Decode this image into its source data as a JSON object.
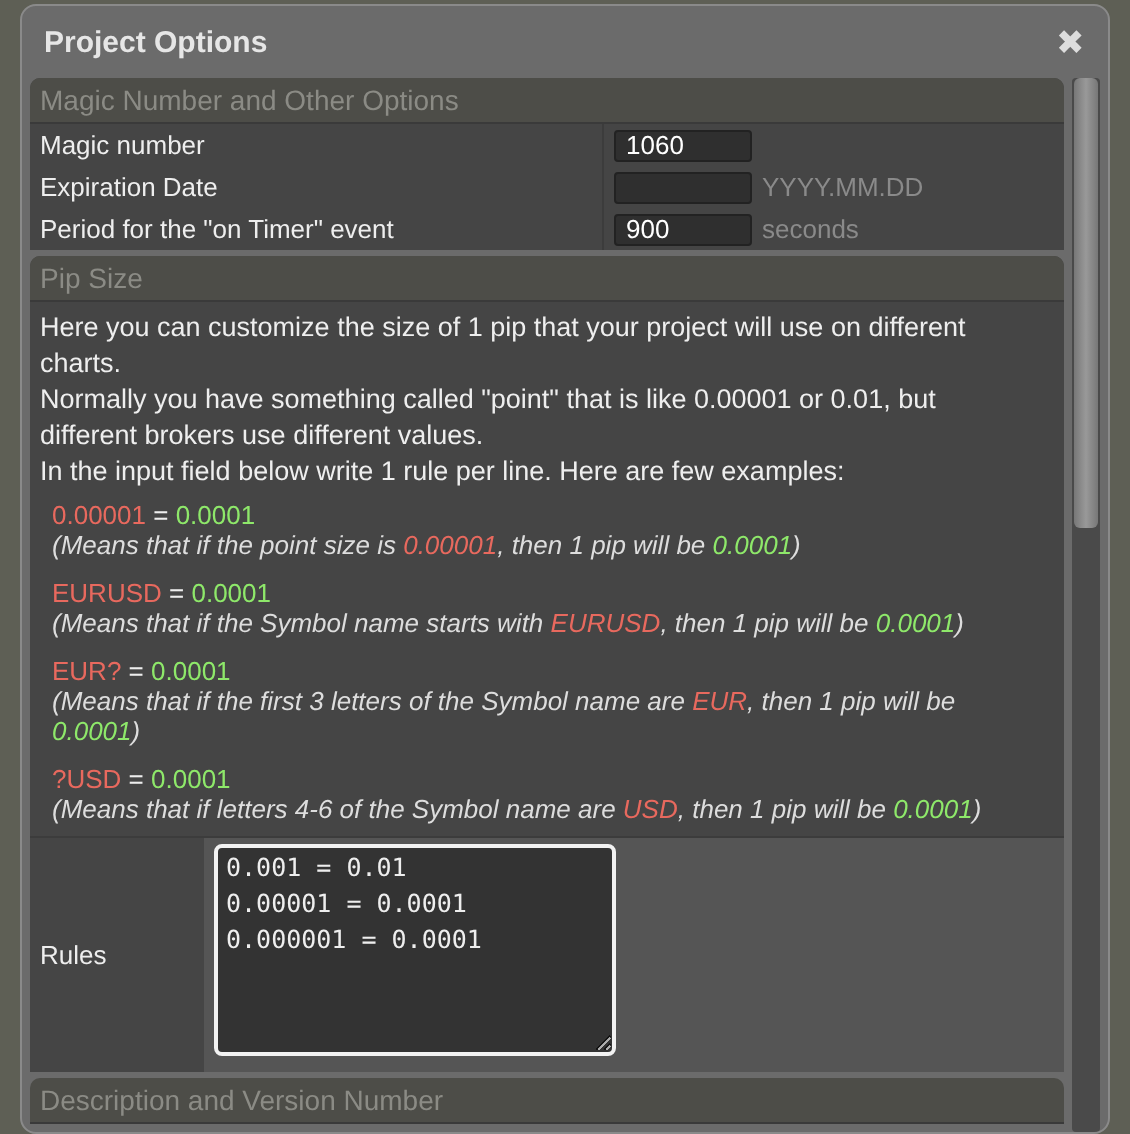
{
  "window": {
    "title": "Project Options",
    "close": "✖"
  },
  "sections": [
    {
      "title": "Magic Number and Other Options",
      "kind": "fields",
      "fields": [
        {
          "label": "Magic number",
          "value": "1060"
        },
        {
          "label": "Expiration Date",
          "hint": "YYYY.MM.DD"
        },
        {
          "label": "Period for the \"on Timer\" event",
          "value": "900",
          "hint": "seconds"
        }
      ]
    },
    {
      "title": "Pip Size",
      "kind": "pip",
      "intro": [
        "Here you can customize the size of 1 pip that your project will use on different charts.",
        "Normally you have something called \"point\" that is like 0.00001 or 0.01, but different brokers use different values.",
        "In the input field below write 1 rule per line. Here are few examples:"
      ],
      "examples": [
        {
          "rule": [
            {
              "text": "0.00001",
              "kind": "pattern"
            },
            {
              "text": " = ",
              "kind": "plain"
            },
            {
              "text": "0.0001",
              "kind": "value"
            }
          ],
          "note": [
            {
              "text": "(Means that if the point size is ",
              "kind": "plain"
            },
            {
              "text": "0.00001",
              "kind": "pattern"
            },
            {
              "text": ", then 1 pip will be ",
              "kind": "plain"
            },
            {
              "text": "0.0001",
              "kind": "value"
            },
            {
              "text": ")",
              "kind": "plain"
            }
          ]
        },
        {
          "rule": [
            {
              "text": "EURUSD",
              "kind": "pattern"
            },
            {
              "text": " = ",
              "kind": "plain"
            },
            {
              "text": "0.0001",
              "kind": "value"
            }
          ],
          "note": [
            {
              "text": "(Means that if the Symbol name starts with ",
              "kind": "plain"
            },
            {
              "text": "EURUSD",
              "kind": "pattern"
            },
            {
              "text": ", then 1 pip will be ",
              "kind": "plain"
            },
            {
              "text": "0.0001",
              "kind": "value"
            },
            {
              "text": ")",
              "kind": "plain"
            }
          ]
        },
        {
          "rule": [
            {
              "text": "EUR?",
              "kind": "pattern"
            },
            {
              "text": " = ",
              "kind": "plain"
            },
            {
              "text": "0.0001",
              "kind": "value"
            }
          ],
          "note": [
            {
              "text": "(Means that if the first 3 letters of the Symbol name are ",
              "kind": "plain"
            },
            {
              "text": "EUR",
              "kind": "pattern"
            },
            {
              "text": ", then 1 pip will be ",
              "kind": "plain"
            },
            {
              "text": "0.0001",
              "kind": "value"
            },
            {
              "text": ")",
              "kind": "plain"
            }
          ]
        },
        {
          "rule": [
            {
              "text": "?USD",
              "kind": "pattern"
            },
            {
              "text": " = ",
              "kind": "plain"
            },
            {
              "text": "0.0001",
              "kind": "value"
            }
          ],
          "note": [
            {
              "text": "(Means that if letters 4-6 of the Symbol name are ",
              "kind": "plain"
            },
            {
              "text": "USD",
              "kind": "pattern"
            },
            {
              "text": ", then 1 pip will be ",
              "kind": "plain"
            },
            {
              "text": "0.0001",
              "kind": "value"
            },
            {
              "text": ")",
              "kind": "plain"
            }
          ]
        }
      ],
      "rules": {
        "label": "Rules",
        "value": "0.001 = 0.01\n0.00001 = 0.0001\n0.000001 = 0.0001"
      }
    },
    {
      "title": "Description and Version Number",
      "kind": "collapsed"
    }
  ]
}
